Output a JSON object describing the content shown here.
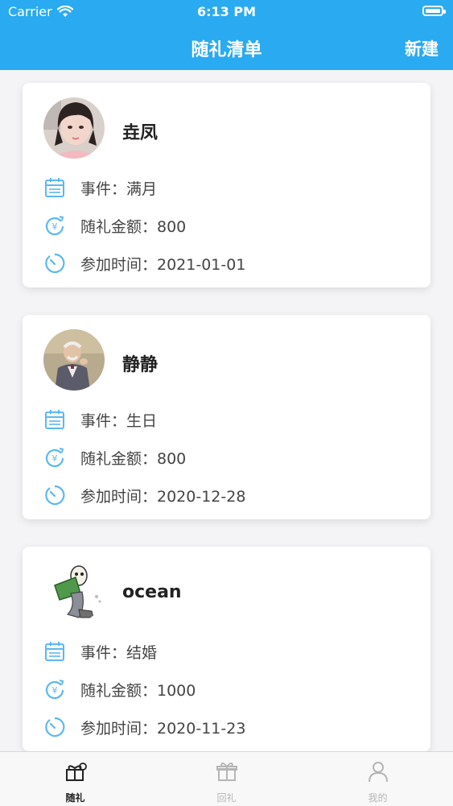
{
  "status_bar": {
    "carrier": "Carrier",
    "time": "6:13 PM"
  },
  "nav": {
    "title": "随礼清单",
    "action": "新建"
  },
  "cards": [
    {
      "name": "垚凤",
      "event": "事件：满月",
      "amount": "随礼金额：800",
      "date": "参加时间：2021-01-01"
    },
    {
      "name": "静静",
      "event": "事件：生日",
      "amount": "随礼金额：800",
      "date": "参加时间：2020-12-28"
    },
    {
      "name": "ocean",
      "event": "事件：结婚",
      "amount": "随礼金额：1000",
      "date": "参加时间：2020-11-23"
    }
  ],
  "tabs": [
    {
      "label": "随礼",
      "active": true
    },
    {
      "label": "回礼",
      "active": false
    },
    {
      "label": "我的",
      "active": false
    }
  ],
  "colors": {
    "accent": "#2aaaf0",
    "icon": "#5ab8ef",
    "tab_active": "#222222",
    "tab_inactive": "#b5b5b5"
  },
  "icons": {
    "event": "calendar-icon",
    "amount": "yuan-coin-icon",
    "date": "clock-icon"
  }
}
